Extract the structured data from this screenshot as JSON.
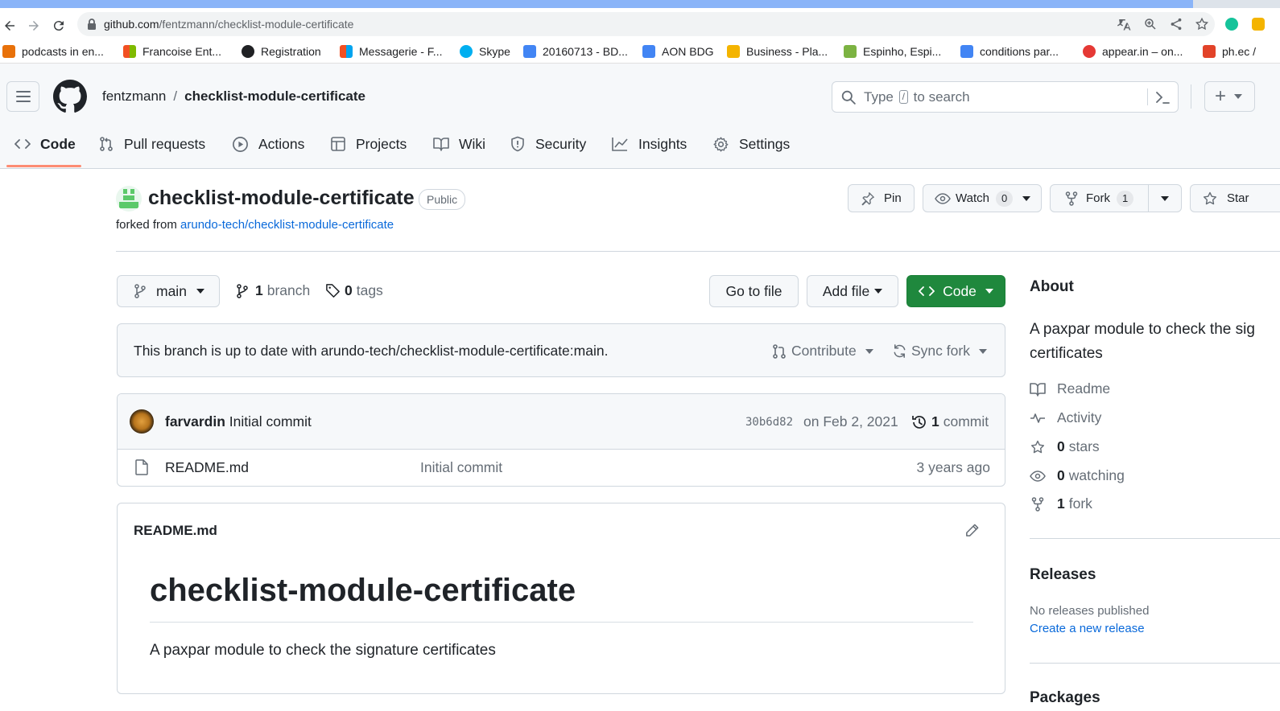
{
  "browser": {
    "url_host": "github.com",
    "url_path": "/fentzmann/checklist-module-certificate",
    "bookmarks": [
      {
        "label": "podcasts in en...",
        "color": "#e8710a"
      },
      {
        "label": "Francoise Ent...",
        "color": "#f25022"
      },
      {
        "label": "Registration",
        "color": "#202124"
      },
      {
        "label": "Messagerie - F...",
        "color": "#f25022"
      },
      {
        "label": "Skype",
        "color": "#00aff0"
      },
      {
        "label": "20160713 - BD...",
        "color": "#4285f4"
      },
      {
        "label": "AON BDG",
        "color": "#4285f4"
      },
      {
        "label": "Business - Pla...",
        "color": "#f4b400"
      },
      {
        "label": "Espinho, Espi...",
        "color": "#7cb342"
      },
      {
        "label": "conditions par...",
        "color": "#4285f4"
      },
      {
        "label": "appear.in – on...",
        "color": "#e53935"
      },
      {
        "label": "ph.ec /",
        "color": "#e24329"
      }
    ]
  },
  "header": {
    "owner": "fentzmann",
    "separator": "/",
    "repo": "checklist-module-certificate",
    "search_before": "Type",
    "search_key": "/",
    "search_after": "to search",
    "plus": "+"
  },
  "tabs": [
    {
      "label": "Code",
      "icon": "code-icon",
      "active": true
    },
    {
      "label": "Pull requests",
      "icon": "pull-request-icon"
    },
    {
      "label": "Actions",
      "icon": "play-icon"
    },
    {
      "label": "Projects",
      "icon": "table-icon"
    },
    {
      "label": "Wiki",
      "icon": "book-icon"
    },
    {
      "label": "Security",
      "icon": "shield-icon"
    },
    {
      "label": "Insights",
      "icon": "graph-icon"
    },
    {
      "label": "Settings",
      "icon": "gear-icon"
    }
  ],
  "repo": {
    "name": "checklist-module-certificate",
    "visibility": "Public",
    "forked_prefix": "forked from",
    "forked_from": "arundo-tech/checklist-module-certificate",
    "pin": "Pin",
    "watch": "Watch",
    "watch_count": "0",
    "fork": "Fork",
    "fork_count": "1",
    "star": "Star"
  },
  "toolbar": {
    "branch": "main",
    "branches_count": "1",
    "branches_label": "branch",
    "tags_count": "0",
    "tags_label": "tags",
    "go_to_file": "Go to file",
    "add_file": "Add file",
    "code": "Code"
  },
  "sync": {
    "message": "This branch is up to date with arundo-tech/checklist-module-certificate:main.",
    "contribute": "Contribute",
    "sync_fork": "Sync fork"
  },
  "commit": {
    "author": "farvardin",
    "message": "Initial commit",
    "sha": "30b6d82",
    "date": "on Feb 2, 2021",
    "count": "1",
    "count_label": "commit"
  },
  "files": [
    {
      "name": "README.md",
      "message": "Initial commit",
      "age": "3 years ago"
    }
  ],
  "readme": {
    "filename": "README.md",
    "heading": "checklist-module-certificate",
    "body": "A paxpar module to check the signature certificates"
  },
  "about": {
    "title": "About",
    "description_line1": "A paxpar module to check the sig",
    "description_line2": "certificates",
    "readme": "Readme",
    "activity": "Activity",
    "stars_count": "0",
    "stars_label": "stars",
    "watching_count": "0",
    "watching_label": "watching",
    "forks_count": "1",
    "forks_label": "fork"
  },
  "releases": {
    "title": "Releases",
    "none": "No releases published",
    "create": "Create a new release"
  },
  "packages": {
    "title": "Packages"
  },
  "colors": {
    "primary_green": "#1f883d",
    "link_blue": "#0969da",
    "tab_underline": "#fd8c73"
  }
}
